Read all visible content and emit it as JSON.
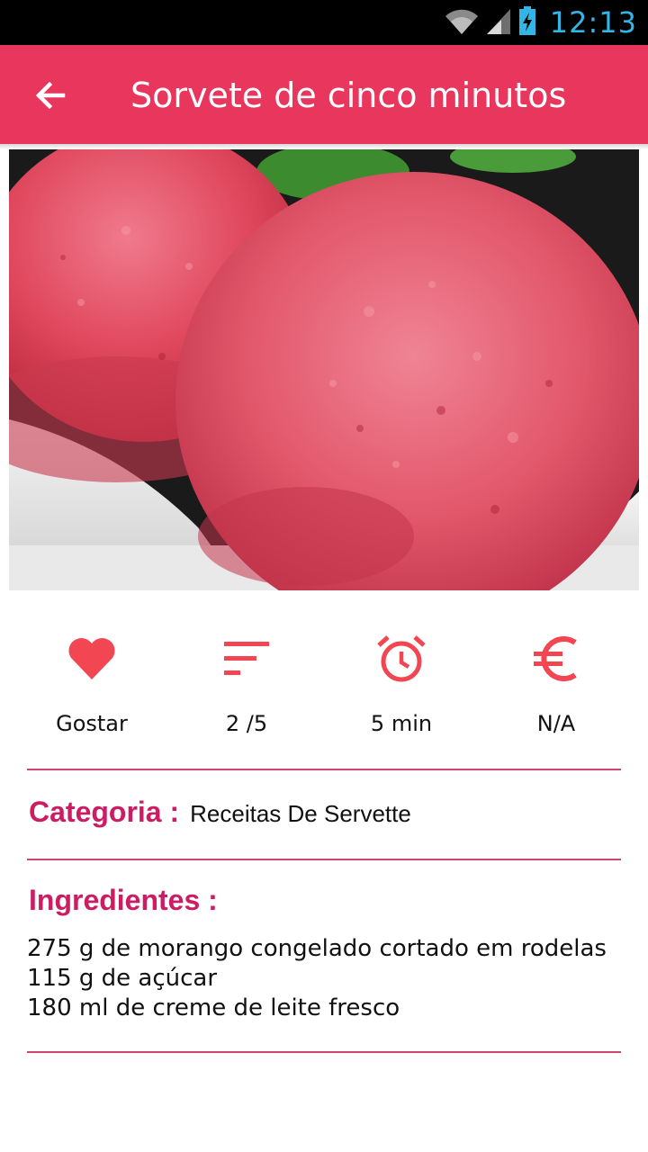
{
  "status_bar": {
    "time": "12:13",
    "icons": [
      "wifi-icon",
      "signal-icon",
      "battery-charging-icon"
    ]
  },
  "app_bar": {
    "title": "Sorvete de cinco minutos",
    "back_icon": "arrow-back-icon"
  },
  "hero_image": {
    "subject": "strawberry-sorbet-photo"
  },
  "stats": [
    {
      "icon": "heart-icon",
      "label": "Gostar"
    },
    {
      "icon": "difficulty-lines-icon",
      "label": "2 /5"
    },
    {
      "icon": "alarm-clock-icon",
      "label": "5 min"
    },
    {
      "icon": "euro-icon",
      "label": "N/A"
    }
  ],
  "category": {
    "title": "Categoria :",
    "value": "Receitas De Servette"
  },
  "ingredients": {
    "title": "Ingredientes :",
    "items": [
      "275 g de morango congelado cortado em rodelas",
      "115 g de açúcar",
      "180 ml de creme de leite fresco"
    ]
  },
  "colors": {
    "primary": "#e8365d",
    "accent_icon": "#f24653",
    "heading": "#cc1d63",
    "divider": "#d0456e",
    "clock": "#33b5e5"
  }
}
